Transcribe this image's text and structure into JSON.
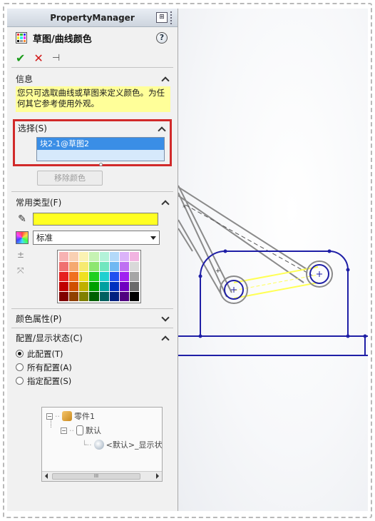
{
  "pm": {
    "title": "PropertyManager",
    "pin_glyph": "⊞"
  },
  "feature": {
    "name": "草图/曲线颜色",
    "help": "?"
  },
  "actions": {
    "ok": "✔",
    "cancel": "✕",
    "pin": "⊣"
  },
  "info": {
    "heading": "信息",
    "message": "您只可选取曲线或草图来定义颜色。为任何其它参考使用外观。"
  },
  "selection": {
    "heading": "选择(S)",
    "items": [
      "块2-1@草图2"
    ],
    "remove_button": "移除颜色"
  },
  "common_types": {
    "heading": "常用类型(F)",
    "current_color": "#ffff22",
    "palette_select": "标准"
  },
  "swatches": [
    "#f7b3b3",
    "#f9d0b3",
    "#fbf2b3",
    "#c6f2b3",
    "#b3f2d9",
    "#b3d9f9",
    "#dbb3f9",
    "#f2b3e1",
    "#f07070",
    "#f5a970",
    "#f7ea70",
    "#8ee670",
    "#70e6bf",
    "#70b8f2",
    "#bf70f2",
    "#d9d9d9",
    "#e62020",
    "#f07020",
    "#f0e020",
    "#20d020",
    "#20d0d0",
    "#2050f0",
    "#a020f0",
    "#a6a6a6",
    "#c00000",
    "#d05000",
    "#c0b000",
    "#00a000",
    "#00a0a0",
    "#0030c0",
    "#7000c0",
    "#6b6b6b",
    "#800000",
    "#904000",
    "#808000",
    "#006000",
    "#006060",
    "#002080",
    "#500080",
    "#000000"
  ],
  "color_props": {
    "heading": "颜色属性(P)"
  },
  "config": {
    "heading": "配置/显示状态(C)",
    "options": [
      "此配置(T)",
      "所有配置(A)",
      "指定配置(S)"
    ],
    "selected_index": 0,
    "tree": {
      "part": "零件1",
      "config": "默认",
      "display": "<默认>_显示状"
    },
    "scroll_label": "III"
  },
  "colors": {
    "sketch_blue": "#1f1fa6",
    "construction_gray": "#8a8a8a",
    "highlight_yellow": "#ffff55",
    "selection_red": "#d12a2a"
  }
}
